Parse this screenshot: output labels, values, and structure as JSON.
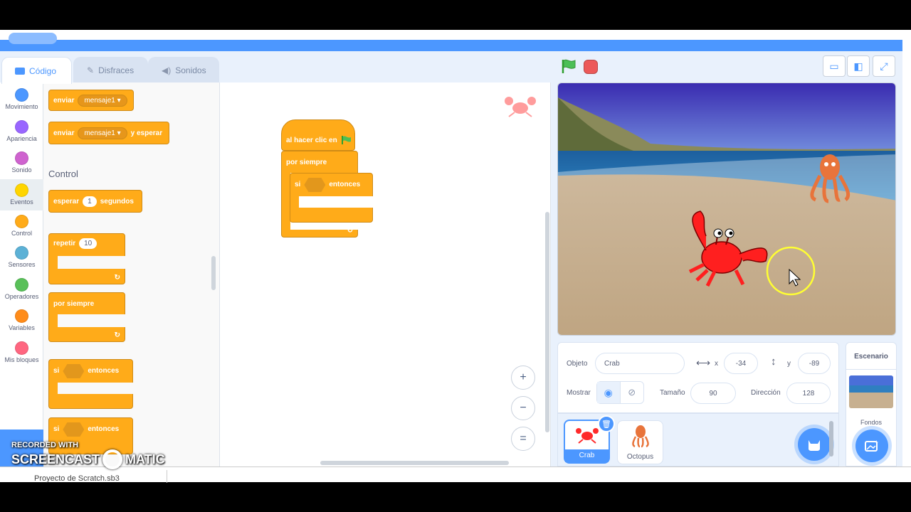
{
  "tabs": {
    "code": "Código",
    "costumes": "Disfraces",
    "sounds": "Sonidos"
  },
  "categories": [
    {
      "label": "Movimiento",
      "color": "#4c97ff"
    },
    {
      "label": "Apariencia",
      "color": "#9966ff"
    },
    {
      "label": "Sonido",
      "color": "#cf63cf"
    },
    {
      "label": "Eventos",
      "color": "#ffd500"
    },
    {
      "label": "Control",
      "color": "#ffab19"
    },
    {
      "label": "Sensores",
      "color": "#5cb1d6"
    },
    {
      "label": "Operadores",
      "color": "#59c059"
    },
    {
      "label": "Variables",
      "color": "#ff8c1a"
    },
    {
      "label": "Mis bloques",
      "color": "#ff6680"
    }
  ],
  "palette": {
    "broadcast": {
      "label": "enviar",
      "message": "mensaje1 ▾"
    },
    "broadcast_wait": {
      "label": "enviar",
      "message": "mensaje1 ▾",
      "suffix": "y esperar"
    },
    "section_control": "Control",
    "wait": {
      "label": "esperar",
      "value": "1",
      "suffix": "segundos"
    },
    "repeat": {
      "label": "repetir",
      "value": "10"
    },
    "forever": "por siempre",
    "if_then": {
      "label": "si",
      "suffix": "entonces"
    },
    "if_else": {
      "label": "si",
      "suffix": "entonces"
    }
  },
  "script": {
    "hat": "al hacer clic en",
    "forever": "por siempre",
    "if_label": "si",
    "if_suffix": "entonces"
  },
  "zoom": {
    "in": "+",
    "out": "−",
    "reset": "="
  },
  "sprite_info": {
    "object_label": "Objeto",
    "object_name": "Crab",
    "x_label": "x",
    "x_value": "-34",
    "y_label": "y",
    "y_value": "-89",
    "show_label": "Mostrar",
    "size_label": "Tamaño",
    "size_value": "90",
    "direction_label": "Dirección",
    "direction_value": "128"
  },
  "sprites": [
    {
      "name": "Crab"
    },
    {
      "name": "Octopus"
    }
  ],
  "backdrop": {
    "title": "Escenario",
    "label": "Fondos"
  },
  "bottom": {
    "file": "Proyecto de Scratch.sb3"
  },
  "watermark": {
    "line1": "RECORDED WITH",
    "line2": "SCREENCAST",
    "line3": "MATIC"
  }
}
